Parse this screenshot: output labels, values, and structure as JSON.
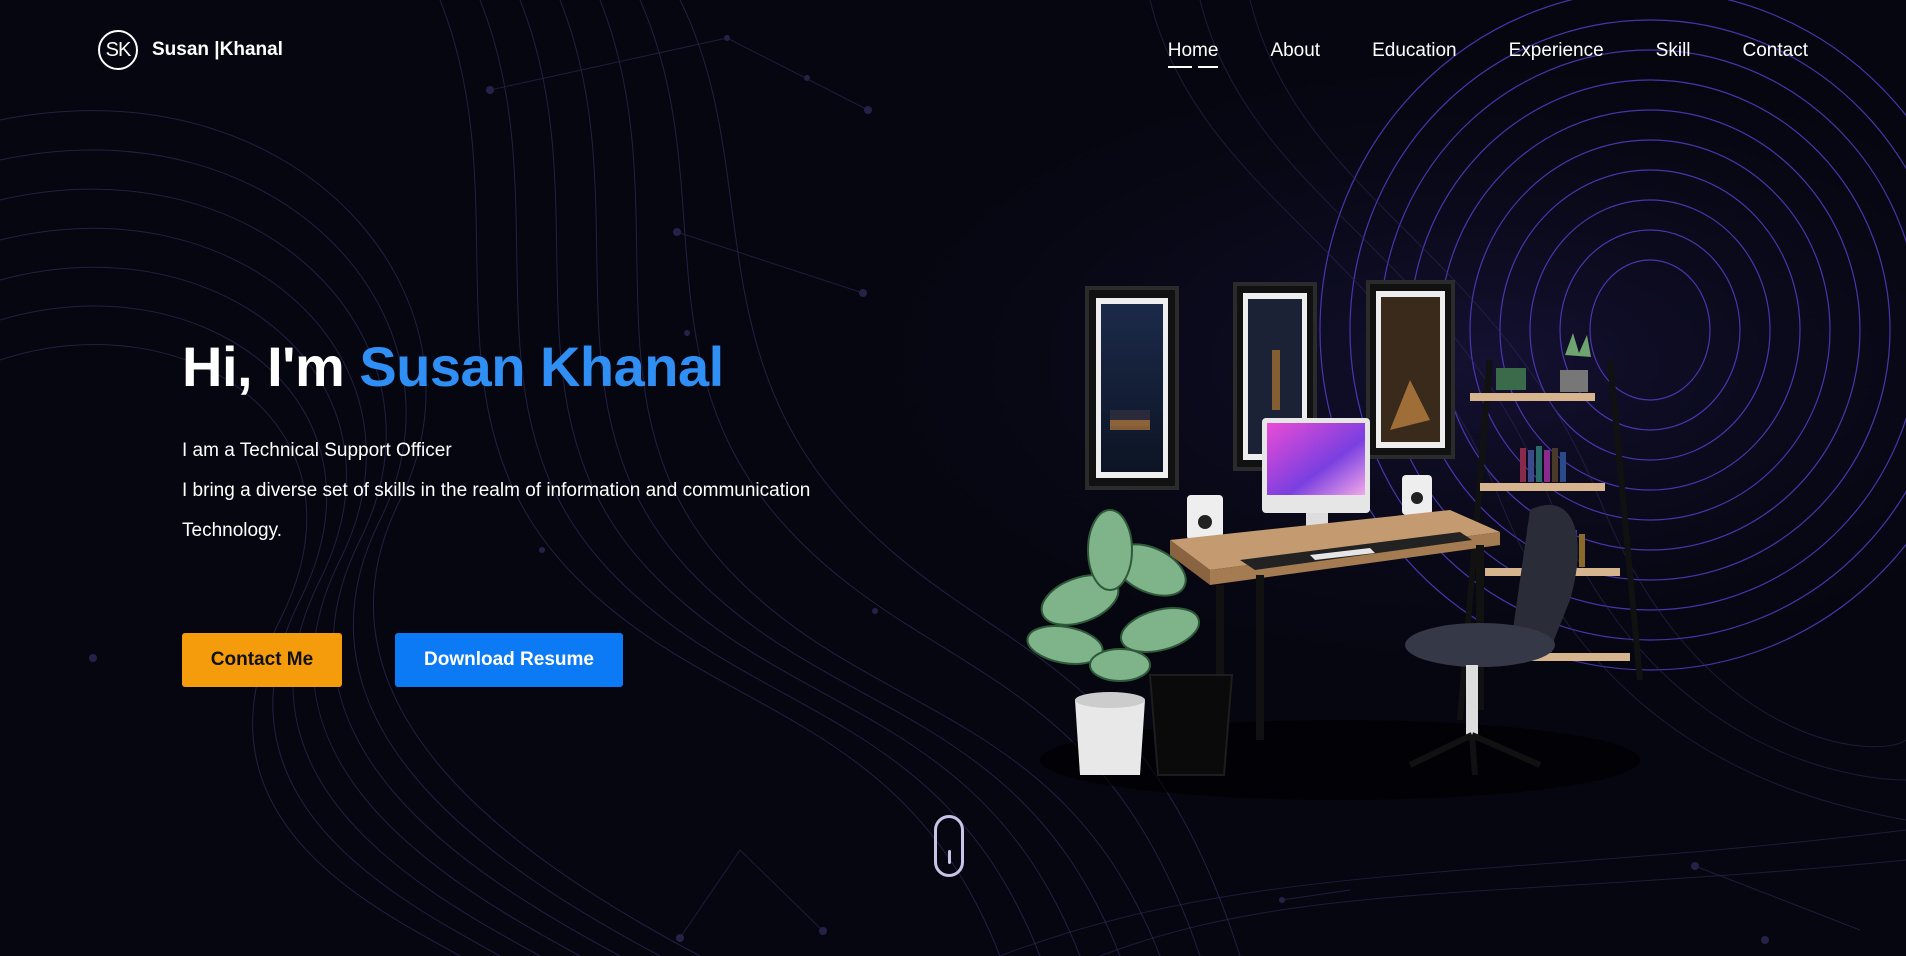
{
  "brand": {
    "monogram": "SK",
    "name": "Susan |Khanal"
  },
  "nav": {
    "items": [
      {
        "label": "Home",
        "active": true
      },
      {
        "label": "About"
      },
      {
        "label": "Education"
      },
      {
        "label": "Experience"
      },
      {
        "label": "Skill"
      },
      {
        "label": "Contact"
      }
    ]
  },
  "hero": {
    "greeting": "Hi, I'm ",
    "name": "Susan Khanal",
    "line1": "I am a Technical Support Officer",
    "line2": "I bring a diverse set of skills in the realm of information and communication",
    "line3": "Technology."
  },
  "buttons": {
    "contact_label": "Contact Me",
    "resume_label": "Download Resume"
  },
  "colors": {
    "background": "#05060f",
    "accent_blue": "#2f8ff4",
    "contact_orange": "#f59c0d",
    "resume_blue": "#0c7af5",
    "wave_purple": "#5b3fd1"
  },
  "icons": {
    "scroll_indicator": "mouse-scroll-icon",
    "illustration": "desk-setup-illustration"
  }
}
